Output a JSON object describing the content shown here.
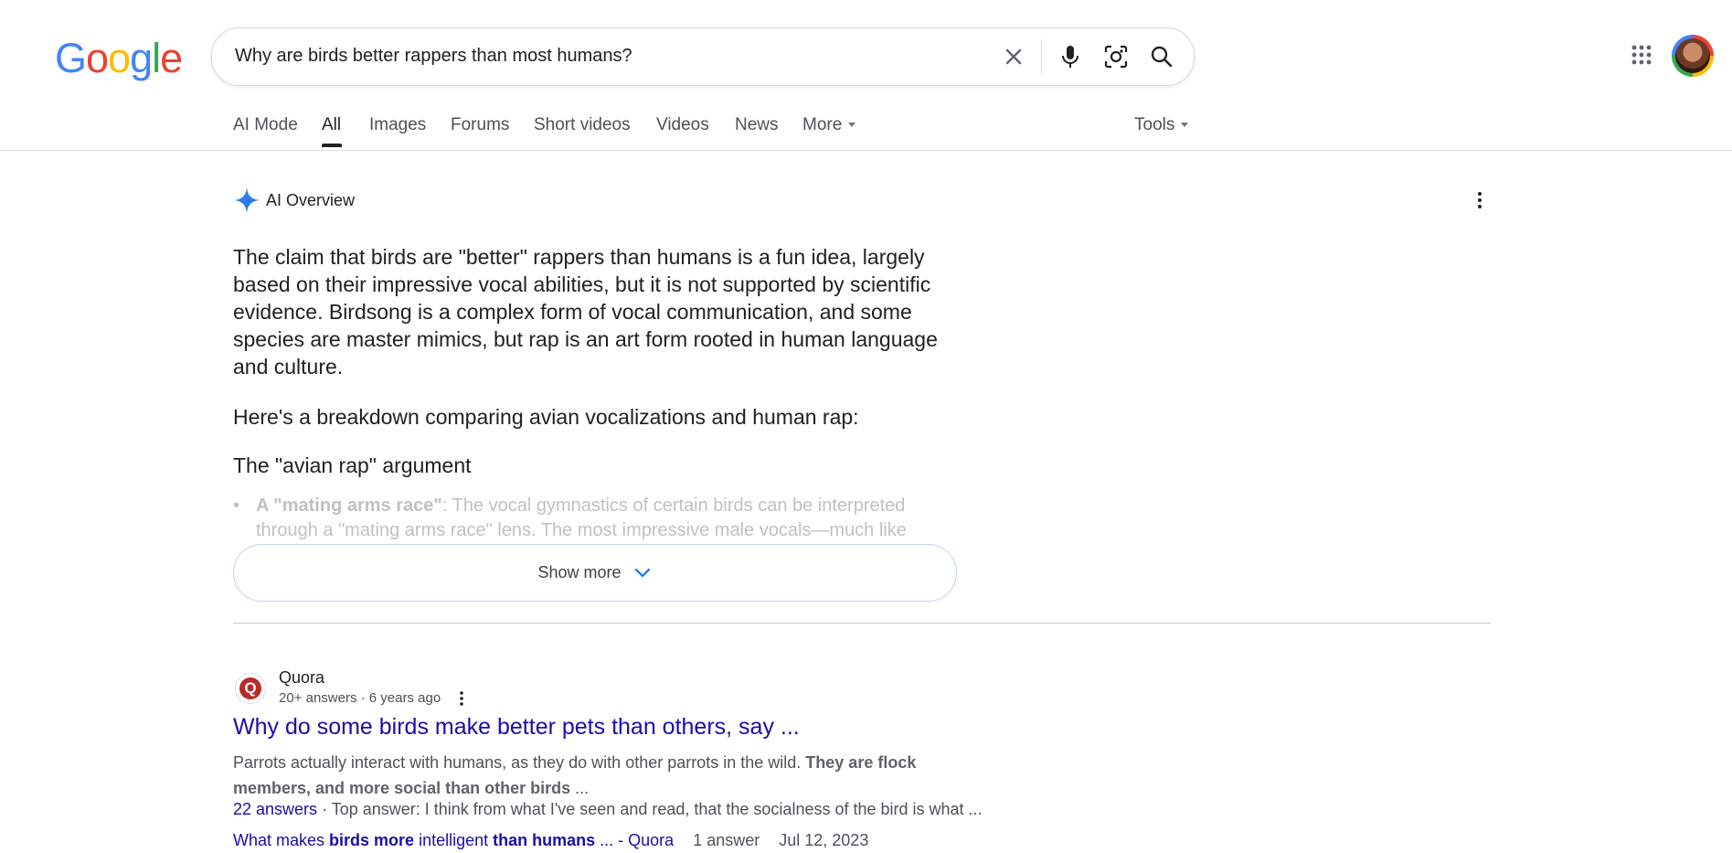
{
  "logo": {
    "text": "Google",
    "letters": [
      "G",
      "o",
      "o",
      "g",
      "l",
      "e"
    ],
    "colors": [
      "#4285f4",
      "#ea4335",
      "#fbbc05",
      "#4285f4",
      "#34a853",
      "#ea4335"
    ]
  },
  "search": {
    "query": "Why are birds better rappers than most humans?"
  },
  "tabs": [
    "AI Mode",
    "All",
    "Images",
    "Forums",
    "Short videos",
    "Videos",
    "News",
    "More"
  ],
  "active_tab": "All",
  "tools_label": "Tools",
  "ai_overview": {
    "title": "AI Overview",
    "paragraph1": "The claim that birds are \"better\" rappers than humans is a fun idea, largely based on their impressive vocal abilities, but it is not supported by scientific evidence. Birdsong is a complex form of vocal communication, and some species are master mimics, but rap is an art form rooted in human language and culture.",
    "paragraph2": "Here's a breakdown comparing avian vocalizations and human rap:",
    "subheading": "The \"avian rap\" argument",
    "bullet_bold": "A \"mating arms race\"",
    "bullet_text": ": The vocal gymnastics of certain birds can be interpreted through a \"mating arms race\" lens. The most impressive male vocals—much like",
    "show_more": "Show more"
  },
  "result": {
    "site_name": "Quora",
    "meta": "20+ answers · 6 years ago",
    "title": "Why do some birds make better pets than others, say ...",
    "snippet_plain": "Parrots actually interact with humans, as they do with other parrots in the wild. ",
    "snippet_bold": "They are flock members, and more social than other birds",
    "snippet_tail": " ...",
    "answers_link": "22 answers",
    "answers_text": " · Top answer: I think from what I've seen and read, that the socialness of the bird is what ...",
    "related": {
      "p1": "What makes ",
      "b1": "birds more",
      "p2": " intelligent ",
      "b2": "than humans",
      "p3": " ... - Quora",
      "count": "1 answer",
      "date": "Jul 12, 2023"
    }
  },
  "icons": [
    "close-icon",
    "microphone-icon",
    "lens-icon",
    "search-icon",
    "apps-grid-icon",
    "sparkle-icon",
    "more-vert-icon",
    "chevron-down-icon"
  ]
}
